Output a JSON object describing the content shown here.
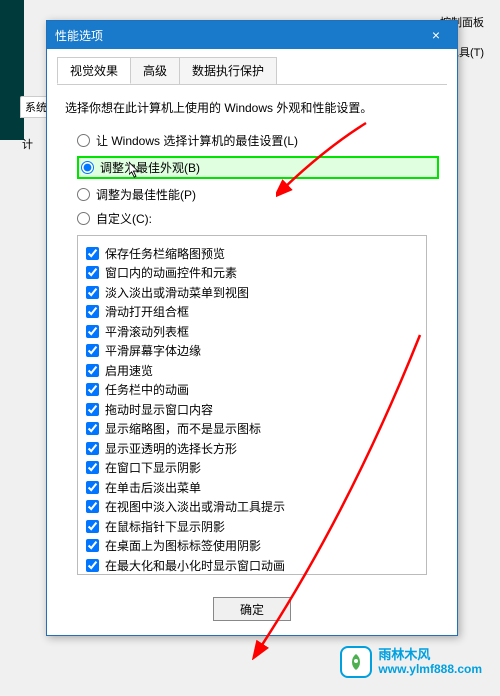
{
  "bg": {
    "tab_label": "系统",
    "partial_label": "计",
    "top_label": "控制面板",
    "tools_label": "工具(T)"
  },
  "dialog": {
    "title": "性能选项",
    "close": "×",
    "tabs": [
      "视觉效果",
      "高级",
      "数据执行保护"
    ],
    "description": "选择你想在此计算机上使用的 Windows 外观和性能设置。",
    "radios": [
      "让 Windows 选择计算机的最佳设置(L)",
      "调整为最佳外观(B)",
      "调整为最佳性能(P)",
      "自定义(C):"
    ],
    "checklist": [
      "保存任务栏缩略图预览",
      "窗口内的动画控件和元素",
      "淡入淡出或滑动菜单到视图",
      "滑动打开组合框",
      "平滑滚动列表框",
      "平滑屏幕字体边缘",
      "启用速览",
      "任务栏中的动画",
      "拖动时显示窗口内容",
      "显示缩略图，而不是显示图标",
      "显示亚透明的选择长方形",
      "在窗口下显示阴影",
      "在单击后淡出菜单",
      "在视图中淡入淡出或滑动工具提示",
      "在鼠标指针下显示阴影",
      "在桌面上为图标标签使用阴影",
      "在最大化和最小化时显示窗口动画"
    ],
    "ok_button": "确定"
  },
  "watermark": {
    "name_cn": "雨林木风",
    "url": "www.ylmf888.com"
  }
}
